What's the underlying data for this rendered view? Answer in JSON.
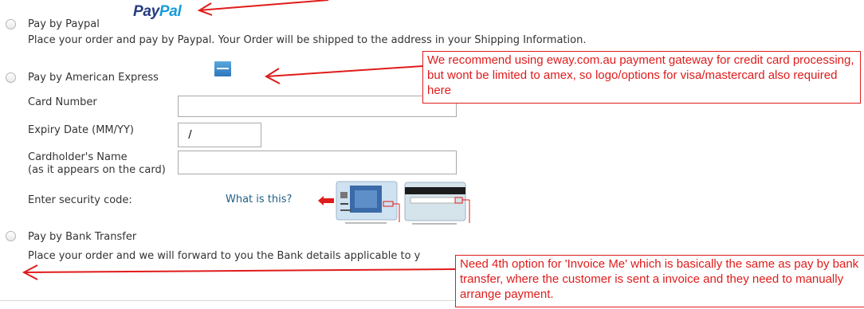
{
  "payment_options": {
    "paypal": {
      "label": "Pay by Paypal",
      "logo_text_a": "Pay",
      "logo_text_b": "Pal",
      "description": "Place your order and pay by Paypal. Your Order will be shipped to the address in your Shipping Information."
    },
    "amex": {
      "label": "Pay by American Express",
      "card_number_label": "Card Number",
      "card_number_value": "",
      "expiry_label": "Expiry Date (MM/YY)",
      "expiry_value": "  /",
      "cardholder_label": "Cardholder's Name",
      "cardholder_sublabel": "(as it appears on the card)",
      "cardholder_value": "",
      "security_code_label": "Enter security code:",
      "what_is_this": "What is this?"
    },
    "bank_transfer": {
      "label": "Pay by Bank Transfer",
      "description": "Place your order and we will forward to you the Bank details applicable to y"
    }
  },
  "annotations": {
    "gateway_note": "We recommend using eway.com.au payment gateway for credit card processing, but wont be limited to amex, so logo/options for visa/mastercard also required here",
    "invoice_note": "Need 4th option for 'Invoice Me' which is basically the same as pay by bank transfer, where the customer is sent a invoice and they need to manually arrange payment."
  },
  "colors": {
    "annotation": "#e01b1b",
    "paypal_dark": "#253b80",
    "paypal_light": "#179bd7",
    "link": "#1f5f85",
    "amex_blue": "#2e77bb"
  },
  "icons": [
    "radio-icon",
    "paypal-logo",
    "amex-logo",
    "red-arrow-icon",
    "card-front-icon",
    "card-back-icon"
  ]
}
